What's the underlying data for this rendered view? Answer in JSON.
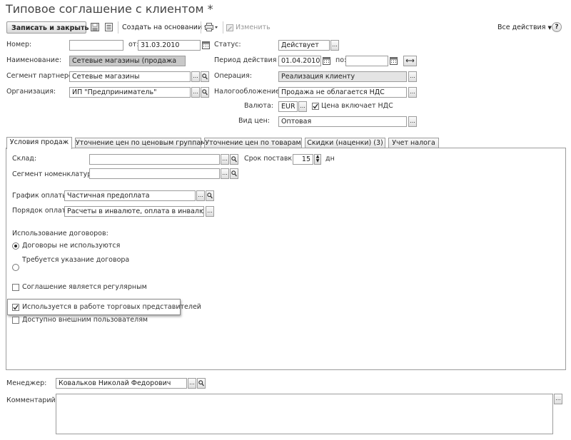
{
  "window": {
    "title": "Типовое соглашение с клиентом *"
  },
  "toolbar": {
    "save_close": "Записать и закрыть",
    "create_based": "Создать на основании",
    "edit": "Изменить",
    "all_actions": "Все действия",
    "help": "?"
  },
  "header": {
    "number_label": "Номер:",
    "number_value": "",
    "date_from_label": "от:",
    "date_from_value": "31.03.2010",
    "name_label": "Наименование:",
    "name_value": "Сетевые магазины (продажа",
    "segment_label": "Сегмент партнеров:",
    "segment_value": "Сетевые магазины",
    "org_label": "Организация:",
    "org_value": "ИП \"Предприниматель\"",
    "status_label": "Статус:",
    "status_value": "Действует",
    "period_label": "Период действия с:",
    "period_from": "01.04.2010",
    "period_to_label": "по:",
    "period_to": "",
    "operation_label": "Операция:",
    "operation_value": "Реализация клиенту",
    "tax_label": "Налогообложение:",
    "tax_value": "Продажа не облагается НДС",
    "currency_label": "Валюта:",
    "currency_value": "EUR",
    "vat_included_label": "Цена включает НДС",
    "vat_included_checked": true,
    "price_type_label": "Вид цен:",
    "price_type_value": "Оптовая"
  },
  "tabs": [
    {
      "label": "Условия продаж",
      "active": true
    },
    {
      "label": "Уточнение цен по ценовым группам",
      "active": false
    },
    {
      "label": "Уточнение цен по товарам",
      "active": false
    },
    {
      "label": "Скидки (наценки) (3)",
      "active": false
    },
    {
      "label": "Учет налога",
      "active": false
    }
  ],
  "sales_terms": {
    "warehouse_label": "Склад:",
    "warehouse_value": "",
    "delivery_label": "Срок поставки:",
    "delivery_value": "15",
    "delivery_unit": "дн",
    "nomenclature_segment_label": "Сегмент номенклатуры:",
    "nomenclature_segment_value": "",
    "payment_schedule_label": "График оплаты:",
    "payment_schedule_value": "Частичная предоплата",
    "payment_order_label": "Порядок оплаты:",
    "payment_order_value": "Расчеты в инвалюте, оплата в  инвалюте",
    "contract_usage_label": "Использование договоров:",
    "radio_no_contracts": "Договоры не используются",
    "radio_contract_required": "Требуется указание договора",
    "regular_label": "Соглашение является регулярным",
    "regular_checked": false,
    "sales_reps_label": "Используется в работе торговых представителей",
    "sales_reps_checked": true,
    "external_users_label": "Доступно внешним пользователям",
    "external_users_checked": false
  },
  "footer": {
    "manager_label": "Менеджер:",
    "manager_value": "Ковальков Николай Федорович",
    "comment_label": "Комментарий:",
    "comment_value": ""
  },
  "icons": {
    "select": "...",
    "search": "search-icon",
    "calendar": "calendar-icon",
    "spin": "spinner-icon",
    "period": "period-icon"
  }
}
